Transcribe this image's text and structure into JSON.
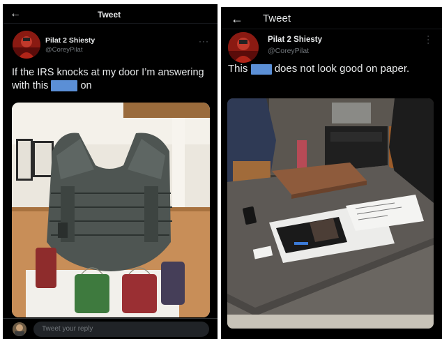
{
  "left": {
    "header": {
      "back_icon": "arrow-left-icon",
      "title": "Tweet"
    },
    "author": {
      "name": "Pilat 2 Shiesty",
      "handle": "@CoreyPilat"
    },
    "tweet": {
      "text_before": "If the IRS knocks at my door I’m answering with this",
      "text_after": "on"
    },
    "photo_icon": "tactical-vest-photo",
    "reply": {
      "placeholder": "Tweet your reply"
    }
  },
  "right": {
    "header": {
      "back_icon": "arrow-left-icon",
      "title": "Tweet"
    },
    "author": {
      "name": "Pilat 2 Shiesty",
      "handle": "@CoreyPilat"
    },
    "tweet": {
      "text_before": "This",
      "text_after": "does not look good on paper."
    },
    "photo_icon": "kitchen-counter-photo"
  },
  "colors": {
    "background": "#000000",
    "text": "#e7e9ea",
    "secondary_text": "#71767b",
    "redaction": "#5b8fd6"
  }
}
